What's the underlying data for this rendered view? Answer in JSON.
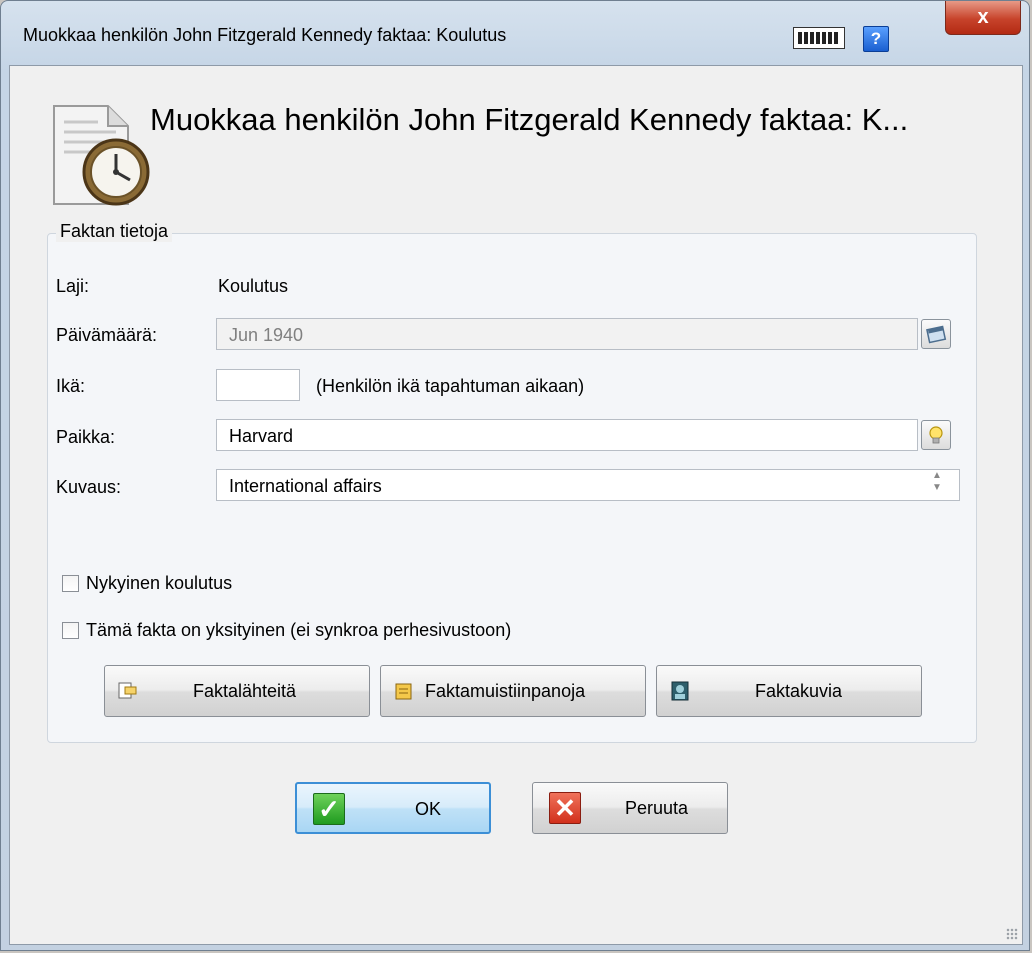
{
  "window": {
    "title": "Muokkaa henkilön John Fitzgerald Kennedy faktaa: Koulutus",
    "help_label": "?",
    "close_label": "x"
  },
  "header": {
    "title": "Muokkaa henkilön John Fitzgerald Kennedy faktaa: K..."
  },
  "group": {
    "legend": "Faktan tietoja",
    "type_label": "Laji:",
    "type_value": "Koulutus",
    "date_label": "Päivämäärä:",
    "date_value": "Jun 1940",
    "age_label": "Ikä:",
    "age_value": "",
    "age_hint": "(Henkilön ikä tapahtuman aikaan)",
    "place_label": "Paikka:",
    "place_value": "Harvard",
    "desc_label": "Kuvaus:",
    "desc_value": "International affairs"
  },
  "checkboxes": {
    "current_label": "Nykyinen koulutus",
    "private_label": "Tämä fakta on yksityinen (ei synkroa perhesivustoon)"
  },
  "buttons": {
    "sources": "Faktalähteitä",
    "notes": "Faktamuistiinpanoja",
    "pictures": "Faktakuvia",
    "ok": "OK",
    "cancel": "Peruuta"
  }
}
